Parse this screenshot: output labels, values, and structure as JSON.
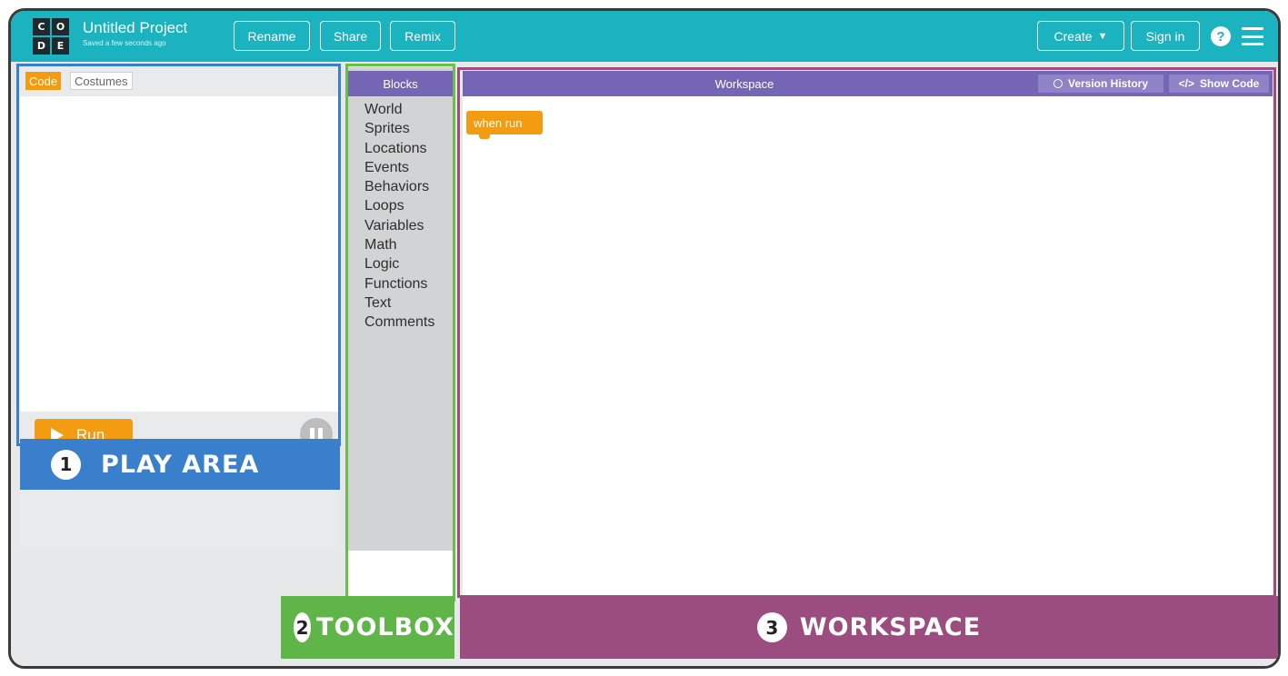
{
  "header": {
    "logo_letters": [
      "C",
      "O",
      "D",
      "E"
    ],
    "project_title": "Untitled Project",
    "saved_status": "Saved a few seconds ago",
    "rename_label": "Rename",
    "share_label": "Share",
    "remix_label": "Remix",
    "create_label": "Create",
    "signin_label": "Sign in",
    "help_glyph": "?",
    "icons": {
      "help": "help-icon",
      "menu": "hamburger-menu-icon",
      "create_dropdown": "caret-down-icon"
    }
  },
  "play_area": {
    "tabs": [
      {
        "label": "Code",
        "active": true
      },
      {
        "label": "Costumes",
        "active": false
      }
    ],
    "run_label": "Run",
    "callout_number": "1",
    "callout_label": "PLAY AREA",
    "color": "#3a7fcb"
  },
  "toolbox": {
    "header": "Blocks",
    "categories": [
      "World",
      "Sprites",
      "Locations",
      "Events",
      "Behaviors",
      "Loops",
      "Variables",
      "Math",
      "Logic",
      "Functions",
      "Text",
      "Comments"
    ],
    "callout_number": "2",
    "callout_label": "TOOLBOX",
    "color": "#5fb548"
  },
  "workspace": {
    "header": "Workspace",
    "version_history_label": "Version History",
    "show_code_label": "Show Code",
    "show_code_glyph": "</>",
    "blocks": [
      {
        "label": "when run"
      }
    ],
    "callout_number": "3",
    "callout_label": "WORKSPACE",
    "color": "#9b4d7f"
  },
  "colors": {
    "header_bg": "#1ab3bf",
    "accent_orange": "#f39c12",
    "block_purple": "#7565b5"
  }
}
